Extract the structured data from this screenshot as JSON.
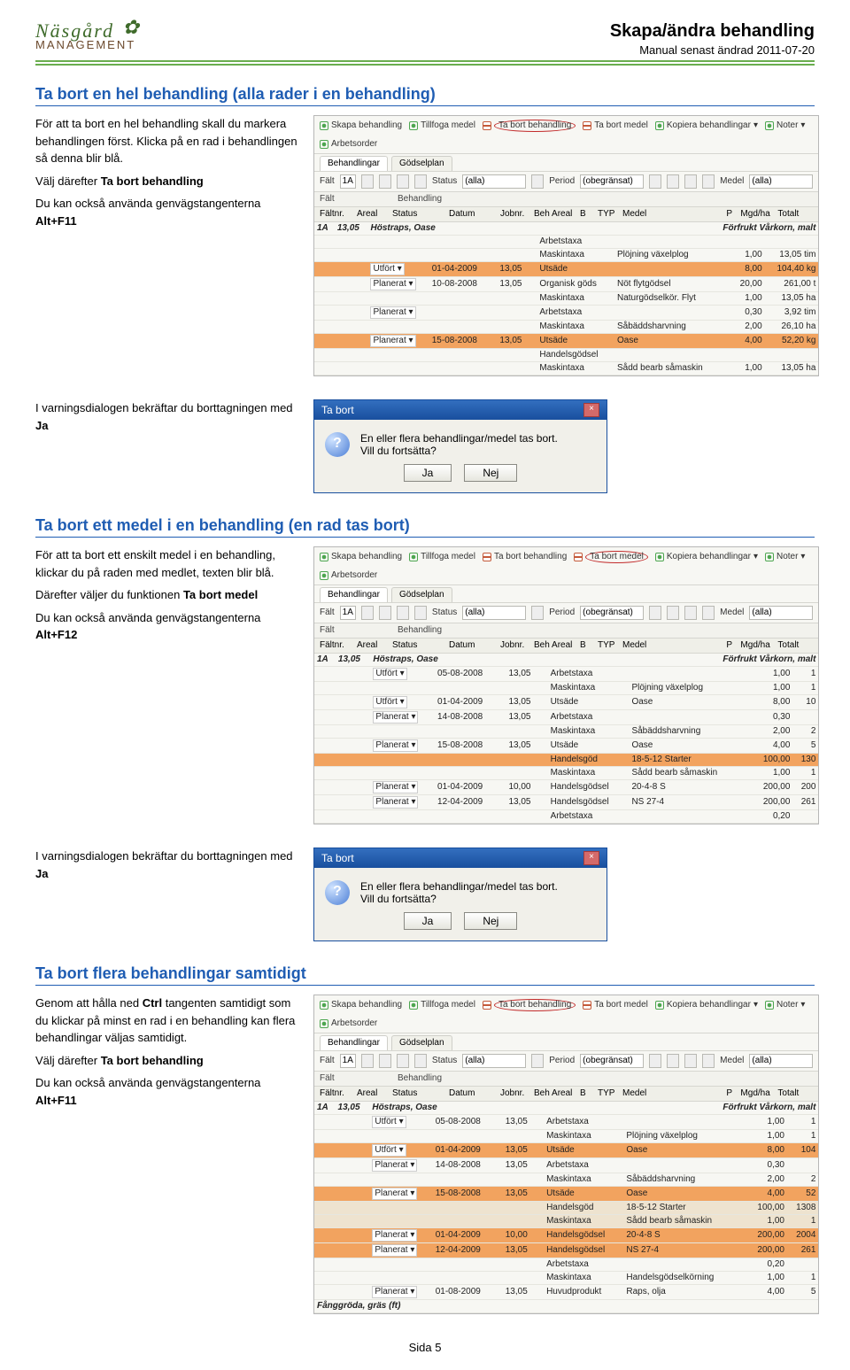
{
  "logo": {
    "top": "Näsgård",
    "icon": "✿",
    "bottom": "MANAGEMENT"
  },
  "doc": {
    "title": "Skapa/ändra behandling",
    "subtitle": "Manual senast ändrad 2011-07-20"
  },
  "toolbar_items": [
    "Skapa behandling",
    "Tillfoga medel",
    "Ta bort behandling",
    "Ta bort medel",
    "Kopiera behandlingar",
    "Noter",
    "Arbetsorder"
  ],
  "tabs": {
    "a": "Behandlingar",
    "b": "Gödselplan"
  },
  "filters": {
    "falt": "Fält",
    "falt_val": "1A",
    "status": "Status",
    "status_val": "(alla)",
    "period": "Period",
    "period_val": "(obegränsat)",
    "medel": "Medel",
    "medel_val": "(alla)"
  },
  "subhead": {
    "left": "Fält",
    "right": "Behandling"
  },
  "cols": {
    "faltnr": "Fältnr.",
    "areal": "Areal",
    "status": "Status",
    "datum": "Datum",
    "jobnr": "Jobnr.",
    "beh_areal": "Beh Areal",
    "b": "B",
    "typ": "TYP",
    "medel": "Medel",
    "p": "P",
    "mgd_ha": "Mgd/ha",
    "totalt": "Totalt"
  },
  "sec1": {
    "heading": "Ta bort en hel behandling (alla rader i en behandling)",
    "p1": "För att ta bort en hel behandling skall du markera behandlingen först. Klicka på en rad i behandlingen så denna blir blå.",
    "p2a": "Välj därefter ",
    "p2b": "Ta bort behandling",
    "p3a": "Du kan också använda genvägstangenterna ",
    "p3b": "Alt+F11",
    "crop": "Höstraps, Oase",
    "crop_sub": "Förfrukt Vårkorn, malt",
    "rows": [
      {
        "d": "",
        "ba": "",
        "t": "Arbetstaxa",
        "m": "",
        "p": "",
        "q": "",
        "r": ""
      },
      {
        "d": "",
        "ba": "",
        "t": "Maskintaxa",
        "m": "Plöjning växelplog",
        "p": "",
        "q": "1,00",
        "r": "13,05 tim"
      },
      {
        "sel": true,
        "s": "Utfört",
        "d": "01-04-2009",
        "ba": "13,05",
        "t": "Utsäde",
        "m": "",
        "p": "",
        "q": "8,00",
        "r": "104,40 kg"
      },
      {
        "s": "Planerat",
        "d": "10-08-2008",
        "ba": "13,05",
        "t": "Organisk göds",
        "m": "Nöt flytgödsel",
        "p": "",
        "q": "20,00",
        "r": "261,00 t"
      },
      {
        "d": "",
        "ba": "",
        "t": "Maskintaxa",
        "m": "Naturgödselkör. Flyt",
        "p": "",
        "q": "1,00",
        "r": "13,05 ha"
      },
      {
        "s": "Planerat",
        "d": "",
        "ba": "",
        "t": "Arbetstaxa",
        "m": "",
        "p": "",
        "q": "0,30",
        "r": "3,92 tim"
      },
      {
        "d": "",
        "ba": "",
        "t": "Maskintaxa",
        "m": "Såbäddsharvning",
        "p": "",
        "q": "2,00",
        "r": "26,10 ha"
      },
      {
        "sel": true,
        "s": "Planerat",
        "d": "15-08-2008",
        "ba": "13,05",
        "t": "Utsäde",
        "m": "Oase",
        "p": "",
        "q": "4,00",
        "r": "52,20 kg"
      },
      {
        "d": "",
        "ba": "",
        "t": "Handelsgödsel",
        "m": "",
        "p": "",
        "q": "",
        "r": ""
      },
      {
        "d": "",
        "ba": "",
        "t": "Maskintaxa",
        "m": "Sådd bearb såmaskin",
        "p": "",
        "q": "1,00",
        "r": "13,05 ha"
      }
    ]
  },
  "conf1": "I varningsdialogen bekräftar du borttagningen med ",
  "conf1b": "Ja",
  "dlg": {
    "title": "Ta bort",
    "l1": "En eller flera behandlingar/medel tas bort.",
    "l2": "Vill du fortsätta?",
    "yes": "Ja",
    "no": "Nej"
  },
  "sec2": {
    "heading": "Ta bort ett medel i en behandling (en rad tas bort)",
    "p1": "För att ta bort ett enskilt medel i en behandling, klickar du på raden med medlet, texten blir blå.",
    "p2a": "Därefter väljer du funktionen ",
    "p2b": "Ta bort medel",
    "p3a": "Du kan också använda genvägstangenterna ",
    "p3b": "Alt+F12",
    "crop": "Höstraps, Oase",
    "crop_sub": "Förfrukt Vårkorn, malt",
    "rows": [
      {
        "s": "Utfört",
        "d": "05-08-2008",
        "ba": "13,05",
        "t": "Arbetstaxa",
        "m": "",
        "p": "",
        "q": "1,00",
        "r": "1"
      },
      {
        "d": "",
        "ba": "",
        "t": "Maskintaxa",
        "m": "Plöjning växelplog",
        "p": "",
        "q": "1,00",
        "r": "1"
      },
      {
        "s": "Utfört",
        "d": "01-04-2009",
        "ba": "13,05",
        "t": "Utsäde",
        "m": "Oase",
        "p": "",
        "q": "8,00",
        "r": "10"
      },
      {
        "s": "Planerat",
        "d": "14-08-2008",
        "ba": "13,05",
        "t": "Arbetstaxa",
        "m": "",
        "p": "",
        "q": "0,30",
        "r": ""
      },
      {
        "d": "",
        "ba": "",
        "t": "Maskintaxa",
        "m": "Såbäddsharvning",
        "p": "",
        "q": "2,00",
        "r": "2"
      },
      {
        "s": "Planerat",
        "d": "15-08-2008",
        "ba": "13,05",
        "t": "Utsäde",
        "m": "Oase",
        "p": "",
        "q": "4,00",
        "r": "5"
      },
      {
        "sel": true,
        "d": "",
        "ba": "",
        "t": "Handelsgöd",
        "m": "18-5-12 Starter",
        "p": "",
        "q": "100,00",
        "r": "130"
      },
      {
        "d": "",
        "ba": "",
        "t": "Maskintaxa",
        "m": "Sådd bearb såmaskin",
        "p": "",
        "q": "1,00",
        "r": "1"
      },
      {
        "s": "Planerat",
        "d": "01-04-2009",
        "ba": "10,00",
        "t": "Handelsgödsel",
        "m": "20-4-8 S",
        "p": "",
        "q": "200,00",
        "r": "200"
      },
      {
        "s": "Planerat",
        "d": "12-04-2009",
        "ba": "13,05",
        "t": "Handelsgödsel",
        "m": "NS 27-4",
        "p": "",
        "q": "200,00",
        "r": "261"
      },
      {
        "d": "",
        "ba": "",
        "t": "Arbetstaxa",
        "m": "",
        "p": "",
        "q": "0,20",
        "r": ""
      }
    ]
  },
  "sec3": {
    "heading": "Ta bort flera behandlingar samtidigt",
    "p1a": "Genom att hålla ned ",
    "p1b": "Ctrl",
    "p1c": " tangenten samtidigt som du klickar på minst en rad i en behandling kan flera behandlingar väljas samtidigt.",
    "p2a": "Välj därefter ",
    "p2b": "Ta bort behandling",
    "p3a": "Du kan också använda genvägstangenterna ",
    "p3b": "Alt+F11",
    "crop": "Höstraps, Oase",
    "crop_sub": "Förfrukt Vårkorn, malt",
    "rows": [
      {
        "s": "Utfört",
        "d": "05-08-2008",
        "ba": "13,05",
        "t": "Arbetstaxa",
        "m": "",
        "p": "",
        "q": "1,00",
        "r": "1"
      },
      {
        "d": "",
        "ba": "",
        "t": "Maskintaxa",
        "m": "Plöjning växelplog",
        "p": "",
        "q": "1,00",
        "r": "1"
      },
      {
        "sel": true,
        "s": "Utfört",
        "d": "01-04-2009",
        "ba": "13,05",
        "t": "Utsäde",
        "m": "Oase",
        "p": "",
        "q": "8,00",
        "r": "104"
      },
      {
        "s": "Planerat",
        "d": "14-08-2008",
        "ba": "13,05",
        "t": "Arbetstaxa",
        "m": "",
        "p": "",
        "q": "0,30",
        "r": ""
      },
      {
        "d": "",
        "ba": "",
        "t": "Maskintaxa",
        "m": "Såbäddsharvning",
        "p": "",
        "q": "2,00",
        "r": "2"
      },
      {
        "sel": true,
        "s": "Planerat",
        "d": "15-08-2008",
        "ba": "13,05",
        "t": "Utsäde",
        "m": "Oase",
        "p": "",
        "q": "4,00",
        "r": "52"
      },
      {
        "soft": true,
        "d": "",
        "ba": "",
        "t": "Handelsgöd",
        "m": "18-5-12 Starter",
        "p": "",
        "q": "100,00",
        "r": "1308"
      },
      {
        "soft": true,
        "d": "",
        "ba": "",
        "t": "Maskintaxa",
        "m": "Sådd bearb såmaskin",
        "p": "",
        "q": "1,00",
        "r": "1"
      },
      {
        "sel": true,
        "s": "Planerat",
        "d": "01-04-2009",
        "ba": "10,00",
        "t": "Handelsgödsel",
        "m": "20-4-8 S",
        "p": "",
        "q": "200,00",
        "r": "2004"
      },
      {
        "sel": true,
        "s": "Planerat",
        "d": "12-04-2009",
        "ba": "13,05",
        "t": "Handelsgödsel",
        "m": "NS 27-4",
        "p": "",
        "q": "200,00",
        "r": "261"
      },
      {
        "d": "",
        "ba": "",
        "t": "Arbetstaxa",
        "m": "",
        "p": "",
        "q": "0,20",
        "r": ""
      },
      {
        "d": "",
        "ba": "",
        "t": "Maskintaxa",
        "m": "Handelsgödselkörning",
        "p": "",
        "q": "1,00",
        "r": "1"
      },
      {
        "s": "Planerat",
        "d": "01-08-2009",
        "ba": "13,05",
        "t": "Huvudprodukt",
        "m": "Raps, olja",
        "p": "",
        "q": "4,00",
        "r": "5"
      }
    ],
    "footer_crop": "Fånggröda, gräs (ft)"
  },
  "footer": "Sida 5"
}
